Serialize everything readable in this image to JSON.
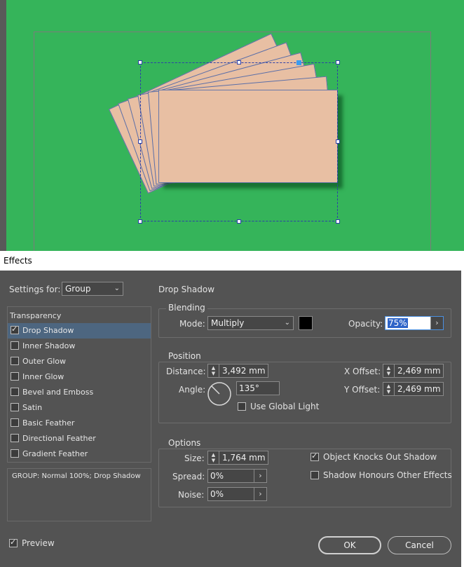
{
  "dialog": {
    "title": "Effects",
    "settings_for_label": "Settings for:",
    "settings_for_value": "Group",
    "section_title": "Drop Shadow"
  },
  "effects_list": {
    "header": "Transparency",
    "items": [
      {
        "label": "Drop Shadow",
        "checked": true,
        "selected": true
      },
      {
        "label": "Inner Shadow",
        "checked": false
      },
      {
        "label": "Outer Glow",
        "checked": false
      },
      {
        "label": "Inner Glow",
        "checked": false
      },
      {
        "label": "Bevel and Emboss",
        "checked": false
      },
      {
        "label": "Satin",
        "checked": false
      },
      {
        "label": "Basic Feather",
        "checked": false
      },
      {
        "label": "Directional Feather",
        "checked": false
      },
      {
        "label": "Gradient Feather",
        "checked": false
      }
    ],
    "summary": "GROUP: Normal 100%; Drop Shadow"
  },
  "blending": {
    "title": "Blending",
    "mode_label": "Mode:",
    "mode_value": "Multiply",
    "swatch_color": "#000000",
    "opacity_label": "Opacity:",
    "opacity_value": "75%"
  },
  "position": {
    "title": "Position",
    "distance_label": "Distance:",
    "distance_value": "3,492 mm",
    "angle_label": "Angle:",
    "angle_value": "135°",
    "angle_degrees": 135,
    "global_light_label": "Use Global Light",
    "x_offset_label": "X Offset:",
    "x_offset_value": "2,469 mm",
    "y_offset_label": "Y Offset:",
    "y_offset_value": "2,469 mm"
  },
  "options": {
    "title": "Options",
    "size_label": "Size:",
    "size_value": "1,764 mm",
    "spread_label": "Spread:",
    "spread_value": "0%",
    "noise_label": "Noise:",
    "noise_value": "0%",
    "knocks_out_label": "Object Knocks Out Shadow",
    "knocks_out_checked": true,
    "honours_label": "Shadow Honours Other Effects",
    "honours_checked": false
  },
  "footer": {
    "preview_label": "Preview",
    "preview_checked": true,
    "ok_label": "OK",
    "cancel_label": "Cancel"
  },
  "colors": {
    "canvas_green": "#35b45a",
    "card_fill": "#e8bfa3",
    "selection": "#2c3fa8",
    "dialog_bg": "#535353",
    "selected_row": "#4d6680",
    "text_highlight": "#2d64c8"
  }
}
